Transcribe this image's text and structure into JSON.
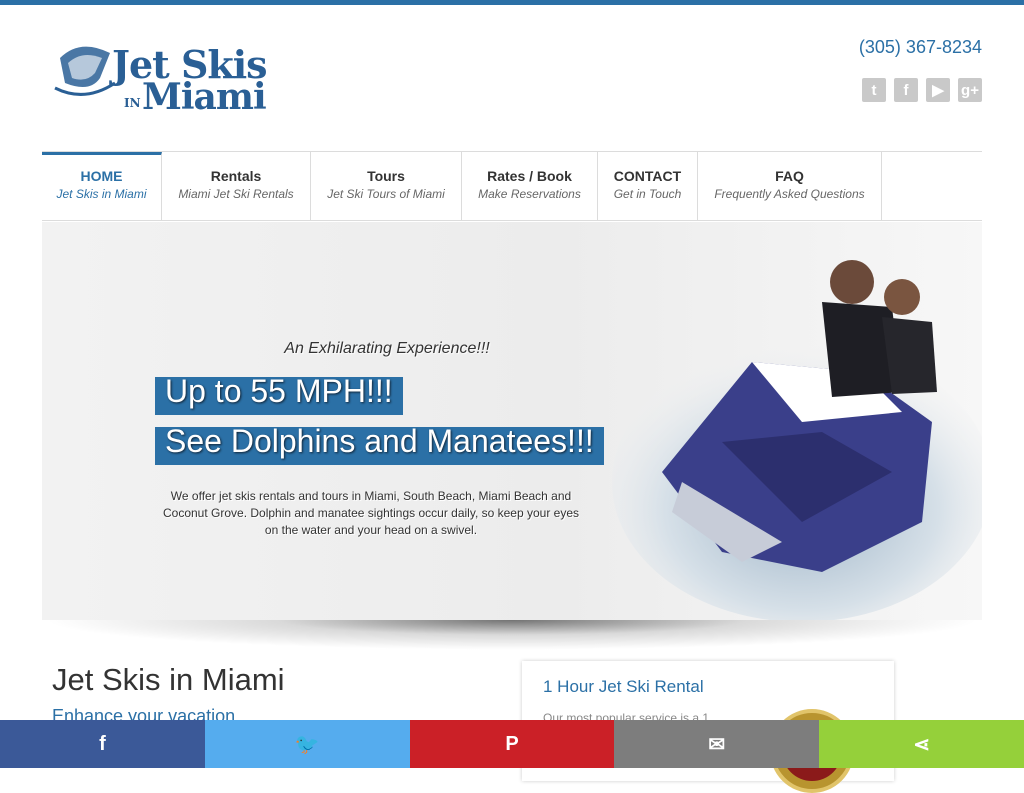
{
  "header": {
    "logo_text_line1": "Jet Skis",
    "logo_text_in": "IN",
    "logo_text_line2": "Miami",
    "phone": "(305) 367-8234",
    "social_icons": [
      "twitter-icon",
      "facebook-icon",
      "youtube-icon",
      "google-plus-icon"
    ]
  },
  "nav": {
    "items": [
      {
        "label": "HOME",
        "sub": "Jet Skis in Miami",
        "active": true
      },
      {
        "label": "Rentals",
        "sub": "Miami Jet Ski Rentals"
      },
      {
        "label": "Tours",
        "sub": "Jet Ski Tours of Miami"
      },
      {
        "label": "Rates / Book",
        "sub": "Make Reservations"
      },
      {
        "label": "CONTACT",
        "sub": "Get in Touch"
      },
      {
        "label": "FAQ",
        "sub": "Frequently Asked Questions"
      }
    ]
  },
  "hero": {
    "tagline": "An Exhilarating Experience!!!",
    "headline1": "Up to 55 MPH!!!",
    "headline2": "See Dolphins and Manatees!!!",
    "description": "We offer jet skis rentals and tours in Miami, South Beach, Miami Beach and Coconut Grove. Dolphin and manatee sightings occur daily, so keep your eyes on the water and your head on a swivel."
  },
  "main": {
    "title": "Jet Skis in Miami",
    "subtitle": "Enhance your vacation"
  },
  "card": {
    "title": "1 Hour Jet Ski Rental",
    "text": "Our most popular service is a 1"
  },
  "share_bar": {
    "buttons": [
      {
        "name": "facebook",
        "glyph": "f",
        "color": "#3b5998"
      },
      {
        "name": "twitter",
        "glyph": "🐦",
        "color": "#55acee"
      },
      {
        "name": "pinterest",
        "glyph": "P",
        "color": "#cb2027"
      },
      {
        "name": "email",
        "glyph": "✉",
        "color": "#7d7d7d"
      },
      {
        "name": "sharethis",
        "glyph": "⋖",
        "color": "#95d03a"
      }
    ]
  },
  "colors": {
    "brand_blue": "#2b70a6"
  }
}
